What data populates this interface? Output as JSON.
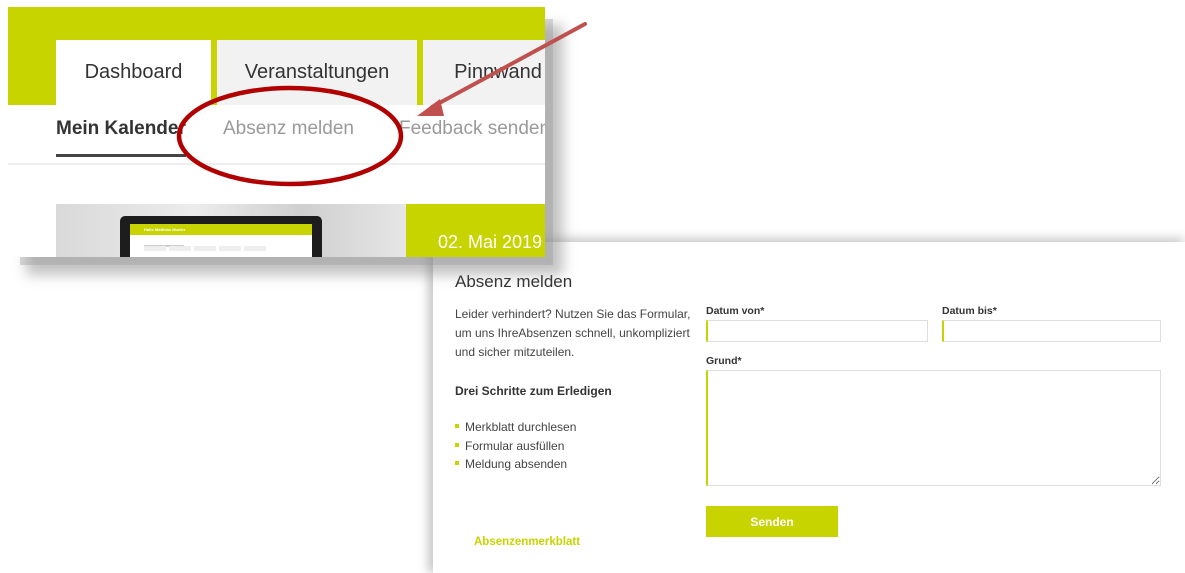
{
  "zoomed_nav": {
    "main_tabs": [
      {
        "label": "Dashboard",
        "active": true
      },
      {
        "label": "Veranstaltungen",
        "active": false
      },
      {
        "label": "Pinnwand",
        "active": false
      }
    ],
    "sub_tabs": [
      {
        "label": "Mein Kalender",
        "active": true
      },
      {
        "label": "Absenz melden",
        "active": false,
        "highlighted": true
      },
      {
        "label": "Feedback senden",
        "active": false
      }
    ],
    "teaser": {
      "date": "02. Mai 2019",
      "laptop_screen_title": "Hallo Matthias Muster"
    }
  },
  "form": {
    "title": "Absenz melden",
    "intro": "Leider verhindert? Nutzen Sie das Formular, um uns IhreAbsenzen schnell, unkompliziert und sicher mitzuteilen.",
    "steps_heading": "Drei Schritte zum Erledigen",
    "steps": [
      "Merkblatt durchlesen",
      "Formular ausfüllen",
      "Meldung absenden"
    ],
    "date_from_label": "Datum von*",
    "date_from_value": "",
    "date_to_label": "Datum bis*",
    "date_to_value": "",
    "reason_label": "Grund*",
    "reason_value": "",
    "submit_label": "Senden",
    "sheet_link": "Absenzenmerkblatt"
  },
  "colors": {
    "accent": "#c8d400",
    "annotation_circle": "#b00000",
    "annotation_arrow": "#c0504d",
    "text": "#333333"
  }
}
